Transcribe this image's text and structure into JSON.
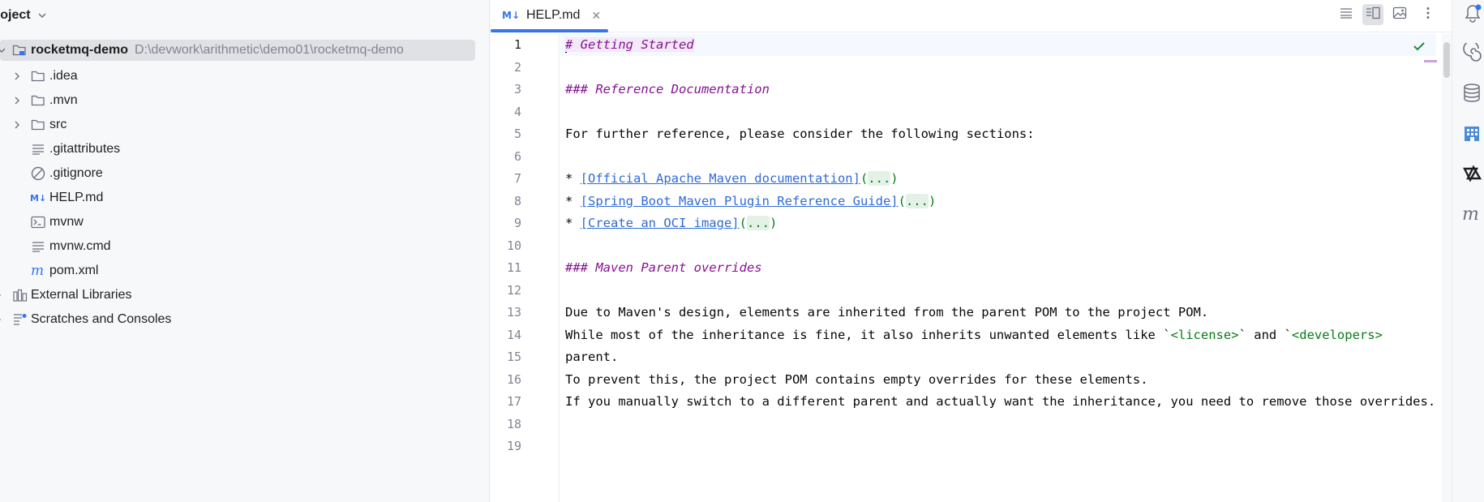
{
  "project_panel": {
    "title": "roject",
    "root": {
      "name": "rocketmq-demo",
      "path": "D:\\devwork\\arithmetic\\demo01\\rocketmq-demo"
    },
    "items": [
      {
        "label": ".idea",
        "icon": "folder-icon"
      },
      {
        "label": ".mvn",
        "icon": "folder-icon"
      },
      {
        "label": "src",
        "icon": "folder-icon"
      },
      {
        "label": ".gitattributes",
        "icon": "text-file-icon"
      },
      {
        "label": ".gitignore",
        "icon": "ignore-file-icon"
      },
      {
        "label": "HELP.md",
        "icon": "markdown-file-icon"
      },
      {
        "label": "mvnw",
        "icon": "shell-script-icon"
      },
      {
        "label": "mvnw.cmd",
        "icon": "text-file-icon"
      },
      {
        "label": "pom.xml",
        "icon": "maven-file-icon"
      }
    ],
    "external_libraries": "External Libraries",
    "scratches": "Scratches and Consoles"
  },
  "editor": {
    "tab": {
      "icon_text": "M↓",
      "label": "HELP.md",
      "close": "✕"
    },
    "line_numbers": [
      "1",
      "2",
      "3",
      "4",
      "5",
      "6",
      "7",
      "8",
      "9",
      "10",
      "11",
      "12",
      "13",
      "14",
      "15",
      "16",
      "17",
      "18",
      "19"
    ],
    "lines": {
      "l1": "# Getting Started",
      "l3": "### Reference Documentation",
      "l5": "For further reference, please consider the following sections:",
      "l7_prefix": "* ",
      "l7_link": "[Official Apache Maven documentation]",
      "l8_prefix": "* ",
      "l8_link": "[Spring Boot Maven Plugin Reference Guide]",
      "l9_prefix": "* ",
      "l9_link": "[Create an OCI image]",
      "fold_open": "(",
      "fold_text": "...",
      "fold_close": ")",
      "l11": "### Maven Parent overrides",
      "l13": "Due to Maven's design, elements are inherited from the parent POM to the project POM.",
      "l14_a": "While most of the inheritance is fine, it also inherits unwanted elements like ",
      "l14_tick1": "`",
      "l14_license": "<license>",
      "l14_tick2": "`",
      "l14_and": " and ",
      "l14_tick3": "`",
      "l14_developers": "<developers>",
      "l15": "parent.",
      "l16": "To prevent this, the project POM contains empty overrides for these elements.",
      "l17": "If you manually switch to a different parent and actually want the inheritance, you need to remove those overrides."
    }
  },
  "colors": {
    "accent": "#3574f0",
    "markdown_header": "#871094",
    "link": "#2f6bd8",
    "code_green": "#067d17"
  }
}
